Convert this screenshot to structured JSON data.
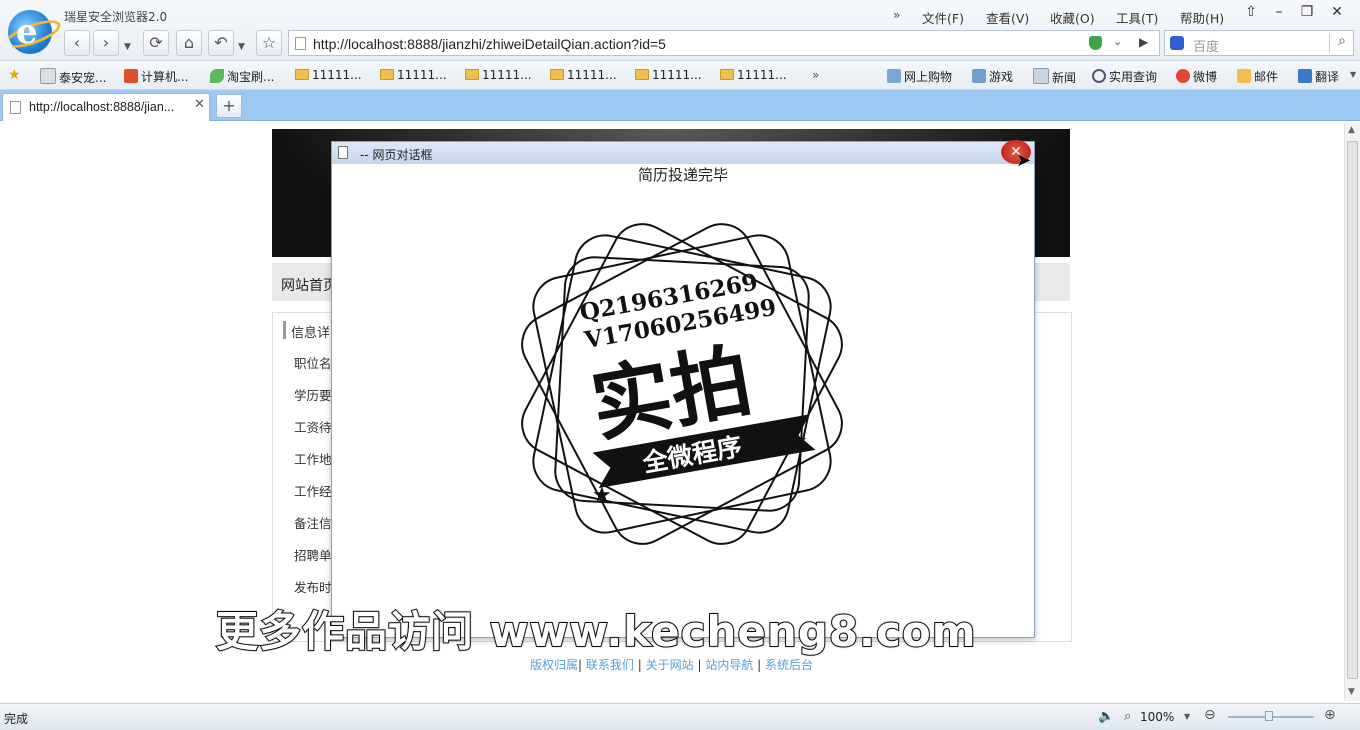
{
  "browser": {
    "title": "瑞星安全浏览器2.0",
    "menu": [
      "文件(F)",
      "查看(V)",
      "收藏(O)",
      "工具(T)",
      "帮助(H)"
    ],
    "address": "http://localhost:8888/jianzhi/zhiweiDetailQian.action?id=5",
    "search_placeholder": "百度",
    "bookmarks": [
      "泰安宠...",
      "计算机...",
      "淘宝刷...",
      "11111...",
      "11111...",
      "11111...",
      "11111...",
      "11111...",
      "11111..."
    ],
    "bookmark_more": "»",
    "quick_links": [
      "网上购物",
      "游戏",
      "新闻",
      "实用查询",
      "微博",
      "邮件",
      "翻译"
    ],
    "tab_label": "http://localhost:8888/jian...",
    "tab_new": "+",
    "status": "完成",
    "zoom": "100%"
  },
  "page": {
    "nav_label": "网站首页",
    "info_heading": "信息详",
    "rows": [
      "职位名",
      "学历要",
      "工资待",
      "工作地",
      "工作经",
      "备注信",
      "招聘单",
      "发布时"
    ],
    "footer_links": [
      "版权归属",
      "联系我们",
      "关于网站",
      "站内导航",
      "系统后台"
    ]
  },
  "dialog": {
    "title": "-- 网页对话框",
    "message": "简历投递完毕",
    "close": "✕"
  },
  "stamp": {
    "line1": "Q2196316269",
    "line2": "V17060256499",
    "main": "实拍",
    "ribbon": "全微程序"
  },
  "watermark": "更多作品访问 www.kecheng8.com"
}
